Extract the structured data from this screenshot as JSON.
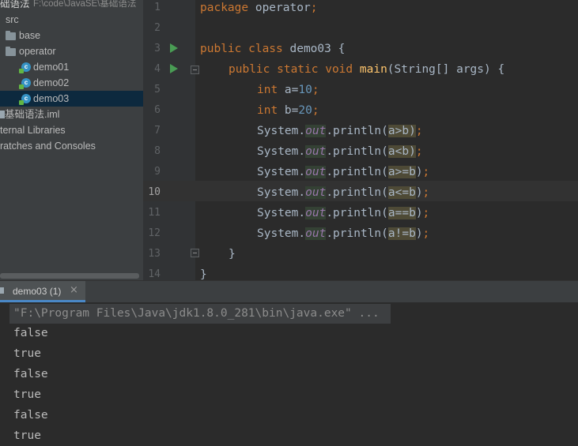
{
  "project_tree": {
    "root_label": "础语法",
    "root_path": "F:\\code\\JavaSE\\基础语法",
    "items": [
      {
        "label": "src"
      },
      {
        "label": "base"
      },
      {
        "label": "operator"
      },
      {
        "label": "demo01"
      },
      {
        "label": "demo02"
      },
      {
        "label": "demo03",
        "selected": true
      },
      {
        "label": "基础语法.iml"
      },
      {
        "label": "ternal Libraries"
      },
      {
        "label": "ratches and Consoles"
      }
    ]
  },
  "editor": {
    "line_numbers": [
      "1",
      "2",
      "3",
      "4",
      "5",
      "6",
      "7",
      "8",
      "9",
      "10",
      "11",
      "12",
      "13",
      "14"
    ],
    "active_line": "10",
    "code": {
      "l1_kw": "package",
      "l1_rest": " operator",
      "l1_semi": ";",
      "l3_kw": "public class",
      "l3_rest": " demo03 {",
      "l4_kw": "public static void",
      "l4_fn": "main",
      "l4_rest": "(String[] args) {",
      "l5_kw": "int",
      "l5_var": " a=",
      "l5_num": "10",
      "l5_semi": ";",
      "l6_kw": "int",
      "l6_var": " b=",
      "l6_num": "20",
      "l6_semi": ";",
      "sys": "System.",
      "out": "out",
      "println": ".println(",
      "close": ")",
      "semi": ";",
      "args": [
        "a>b",
        "a<b",
        "a>=b",
        "a<=b",
        "a==b",
        "a!=b"
      ],
      "l13": "}",
      "l14": "}"
    }
  },
  "run_panel": {
    "tab_label": "demo03 (1)",
    "tab_close": "×",
    "command": "\"F:\\Program Files\\Java\\jdk1.8.0_281\\bin\\java.exe\" ...",
    "outputs": [
      "false",
      "true",
      "false",
      "true",
      "false",
      "true"
    ]
  },
  "colors": {
    "keyword": "#cc7832",
    "number": "#6897bb",
    "function": "#ffc66d",
    "static_field": "#9876aa",
    "selection": "#0d293e",
    "run_arrow": "#499c54"
  },
  "icons": {
    "folder": "folder-icon",
    "java_class": "java-class-icon",
    "run_gutter": "run-gutter-icon",
    "fold": "fold-icon"
  }
}
